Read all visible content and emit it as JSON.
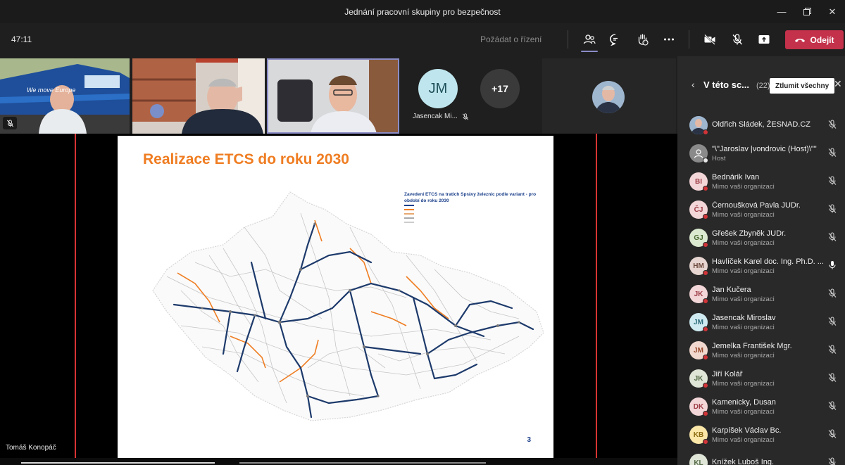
{
  "window": {
    "title": "Jednání pracovní skupiny pro bezpečnost"
  },
  "toolbar": {
    "timer": "47:11",
    "raise_hand_label": "Požádat o řízení",
    "leave_label": "Odejít"
  },
  "strip": {
    "jm_initials": "JM",
    "jm_name": "Jasencak Mi...",
    "more_count": "+17"
  },
  "slide": {
    "title": "Realizace ETCS do roku 2030",
    "legend_title": "Zavedení ETCS na tratích Správy železnic podle variant - pro období do roku 2030",
    "page_number": "3"
  },
  "presenter_name": "Tomáš Konopáč",
  "roster": {
    "title": "V této sc...",
    "count": "(22)",
    "mute_all_label": "Ztlumit všechny",
    "participants": [
      {
        "initials": "",
        "name": "Oldřich Sládek, ŽESNAD.CZ",
        "sub": "",
        "avatar_color": "#5a6b8a",
        "photo": true,
        "status": "#d13438",
        "mic": "muted"
      },
      {
        "initials": "",
        "name": "\"\\\"Jaroslav |vondrovic (Host)\\\"\"",
        "sub": "Host",
        "avatar_color": "#8a8a8a",
        "photo": false,
        "status": "#e8e8e8",
        "mic": "muted"
      },
      {
        "initials": "BI",
        "name": "Bednárik Ivan",
        "sub": "Mimo vaši organizaci",
        "avatar_color": "#f3d6d8",
        "text_color": "#9c3c45",
        "status": "#d13438",
        "mic": "muted"
      },
      {
        "initials": "ČJ",
        "name": "Černoušková Pavla JUDr.",
        "sub": "Mimo vaši organizaci",
        "avatar_color": "#f3d6d8",
        "text_color": "#9c3c45",
        "status": "#d13438",
        "mic": "muted"
      },
      {
        "initials": "GJ",
        "name": "Gřešek Zbyněk JUDr.",
        "sub": "Mimo vaši organizaci",
        "avatar_color": "#dbe9d0",
        "text_color": "#4c6b34",
        "status": "#d13438",
        "mic": "muted"
      },
      {
        "initials": "HM",
        "name": "Havlíček Karel doc. Ing. Ph.D. ...",
        "sub": "Mimo vaši organizaci",
        "avatar_color": "#e6d5d0",
        "text_color": "#6e4a3e",
        "status": "#d13438",
        "mic": "on"
      },
      {
        "initials": "JK",
        "name": "Jan Kučera",
        "sub": "Mimo vaši organizaci",
        "avatar_color": "#f3d6d8",
        "text_color": "#9c3c45",
        "status": "#d13438",
        "mic": "muted"
      },
      {
        "initials": "JM",
        "name": "Jasencak Miroslav",
        "sub": "Mimo vaši organizaci",
        "avatar_color": "#cfeaf0",
        "text_color": "#2f6e7d",
        "status": "#d13438",
        "mic": "muted"
      },
      {
        "initials": "JM",
        "name": "Jemelka František Mgr.",
        "sub": "Mimo vaši organizaci",
        "avatar_color": "#f1d9cf",
        "text_color": "#9a4b2e",
        "status": "#d13438",
        "mic": "muted"
      },
      {
        "initials": "JK",
        "name": "Jiří Kolář",
        "sub": "Mimo vaši organizaci",
        "avatar_color": "#dfe6d8",
        "text_color": "#566b48",
        "status": "#d13438",
        "mic": "muted"
      },
      {
        "initials": "DK",
        "name": "Kamenicky, Dusan",
        "sub": "Mimo vaši organizaci",
        "avatar_color": "#f3d6d8",
        "text_color": "#9c3c45",
        "status": "#d13438",
        "mic": "muted"
      },
      {
        "initials": "KB",
        "name": "Karpíšek Václav Bc.",
        "sub": "Mimo vaši organizaci",
        "avatar_color": "#fbe7a8",
        "text_color": "#8a6a10",
        "status": "#d13438",
        "mic": "muted"
      },
      {
        "initials": "KL",
        "name": "Knížek Luboš Ing.",
        "sub": "",
        "avatar_color": "#dfe6d8",
        "text_color": "#566b48",
        "status": "#d13438",
        "mic": "muted"
      }
    ]
  }
}
